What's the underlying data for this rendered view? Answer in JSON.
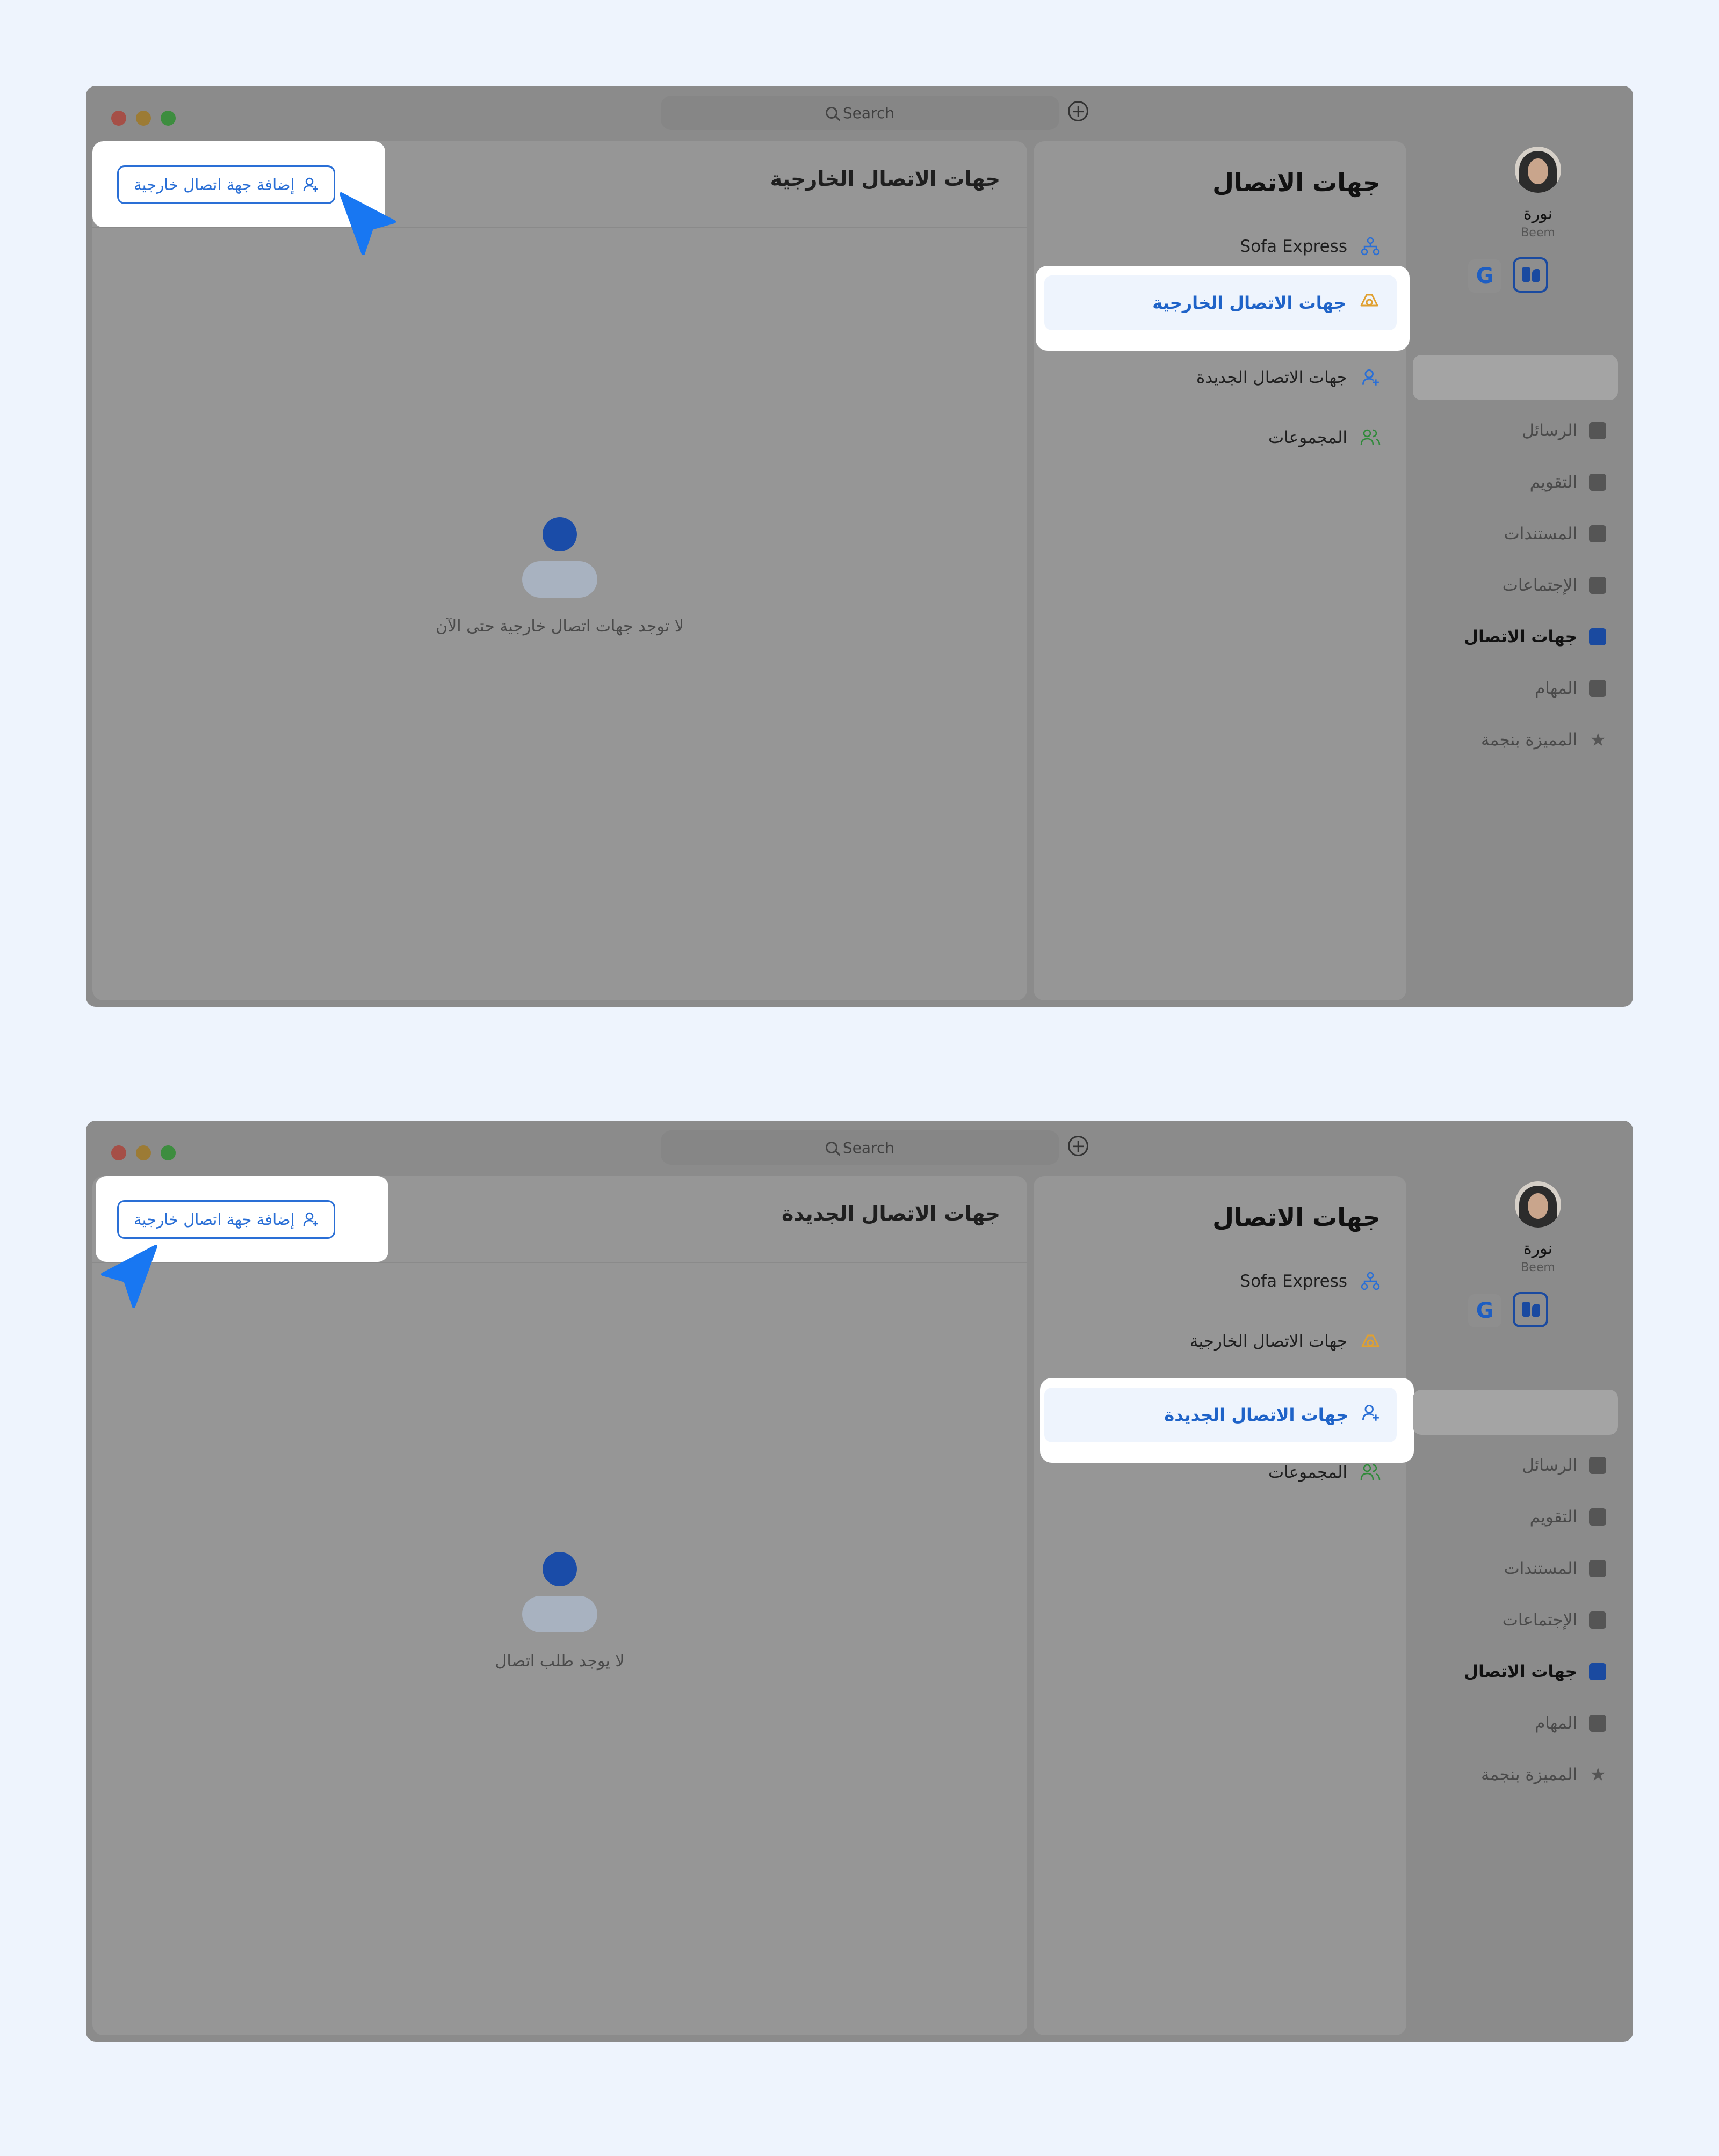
{
  "search": {
    "label": "Search"
  },
  "sidebar_user": {
    "name": "نورة",
    "org": "Beem",
    "g_label": "G"
  },
  "nav": [
    "الرسائل",
    "التقويم",
    "المستندات",
    "الإجتماعات",
    "جهات الاتصال",
    "المهام",
    "المميزة بنجمة"
  ],
  "contacts": {
    "title": "جهات الاتصال",
    "items": [
      "Sofa Express",
      "جهات الاتصال الخارجية",
      "جهات الاتصال الجديدة",
      "المجموعات"
    ]
  },
  "screens": [
    {
      "main_title": "جهات الاتصال الخارجية",
      "add_button_label": "إضافة جهة اتصال خارجية",
      "empty_text": "لا توجد جهات اتصال خارجية حتى الآن",
      "active_contact_index": 1
    },
    {
      "main_title": "جهات الاتصال الجديدة",
      "add_button_label": "إضافة جهة اتصال خارجية",
      "empty_text": "لا يوجد طلب اتصال",
      "active_contact_index": 2
    }
  ],
  "colors": {
    "accent": "#1f63c8",
    "pointer": "#1877f2",
    "overlay": "#8b8b8b"
  }
}
